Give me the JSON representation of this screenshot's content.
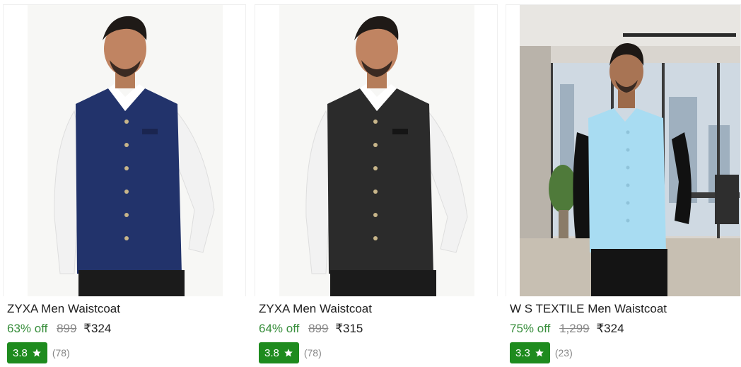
{
  "products": [
    {
      "title": "ZYXA Men Waistcoat",
      "discount": "63% off",
      "mrp": "899",
      "price": "₹324",
      "rating": "3.8",
      "rating_count": "(78)",
      "image": "navy-waistcoat-photo"
    },
    {
      "title": "ZYXA Men Waistcoat",
      "discount": "64% off",
      "mrp": "899",
      "price": "₹315",
      "rating": "3.8",
      "rating_count": "(78)",
      "image": "black-waistcoat-photo"
    },
    {
      "title": "W S TEXTILE Men Waistcoat",
      "discount": "75% off",
      "mrp": "1,299",
      "price": "₹324",
      "rating": "3.3",
      "rating_count": "(23)",
      "image": "sky-blue-waistcoat-photo"
    }
  ],
  "colors": {
    "discount": "#388e3c",
    "rating_badge": "#1e8b1e",
    "muted": "#878787"
  },
  "icons": {
    "rating": "star-icon"
  }
}
